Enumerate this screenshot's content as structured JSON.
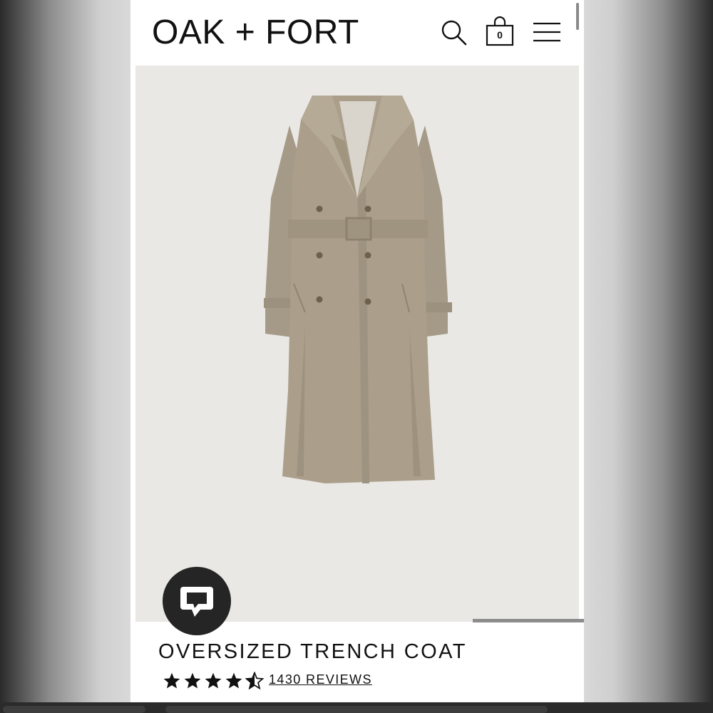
{
  "brand": {
    "logo_text": "OAK + FORT"
  },
  "header": {
    "cart_count": "0",
    "icons": [
      "search-icon",
      "shopping-bag-icon",
      "hamburger-menu-icon"
    ]
  },
  "product": {
    "title": "OVERSIZED TRENCH COAT",
    "rating": {
      "stars": 4.5,
      "max": 5
    },
    "reviews_label": "1430 REVIEWS",
    "image": {
      "subject": "coat-image",
      "color": "#a89d8a"
    }
  },
  "gallery": {
    "progress": 0.25
  },
  "chat": {
    "icon": "chat-bubble-icon"
  },
  "colors": {
    "accent": "#111111",
    "background": "#ffffff",
    "hero_bg": "#e9e8e5"
  }
}
